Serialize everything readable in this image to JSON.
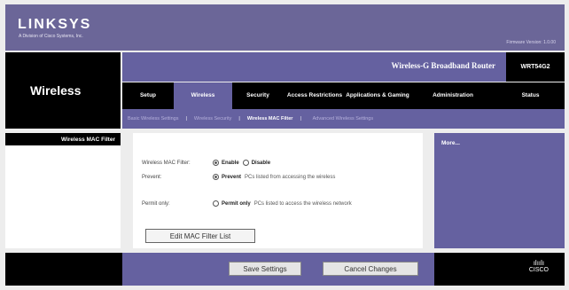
{
  "brand": {
    "logo": "LINKSYS",
    "tagline": "A Division of Cisco Systems, Inc.",
    "firmware": "Firmware Version: 1.0.00"
  },
  "product": {
    "name": "Wireless-G Broadband Router",
    "model": "WRT54G2"
  },
  "section": {
    "title": "Wireless"
  },
  "tabs": [
    {
      "label": "Setup",
      "active": false
    },
    {
      "label": "Wireless",
      "active": true
    },
    {
      "label": "Security",
      "active": false
    },
    {
      "label": "Access Restrictions",
      "active": false
    },
    {
      "label": "Applications & Gaming",
      "active": false
    },
    {
      "label": "Administration",
      "active": false
    },
    {
      "label": "Status",
      "active": false
    }
  ],
  "subtabs": [
    {
      "label": "Basic Wireless Settings",
      "active": false
    },
    {
      "label": "Wireless Security",
      "active": false
    },
    {
      "label": "Wireless MAC Filter",
      "active": true
    },
    {
      "label": "Advanced Wireless Settings",
      "active": false
    }
  ],
  "leftnav": {
    "item": "Wireless MAC Filter"
  },
  "form": {
    "mac_filter_label": "Wireless MAC Filter:",
    "enable_label": "Enable",
    "disable_label": "Disable",
    "prevent_label": "Prevent:",
    "prevent_strong": "Prevent",
    "prevent_rest": "PCs listed from accessing the wireless",
    "permit_label": "Permit only:",
    "permit_strong": "Permit only",
    "permit_rest": "PCs listed to access the wireless network",
    "edit_button": "Edit MAC Filter List"
  },
  "help": {
    "more": "More..."
  },
  "footer": {
    "save": "Save Settings",
    "cancel": "Cancel Changes",
    "cisco_word": "CISCO"
  }
}
